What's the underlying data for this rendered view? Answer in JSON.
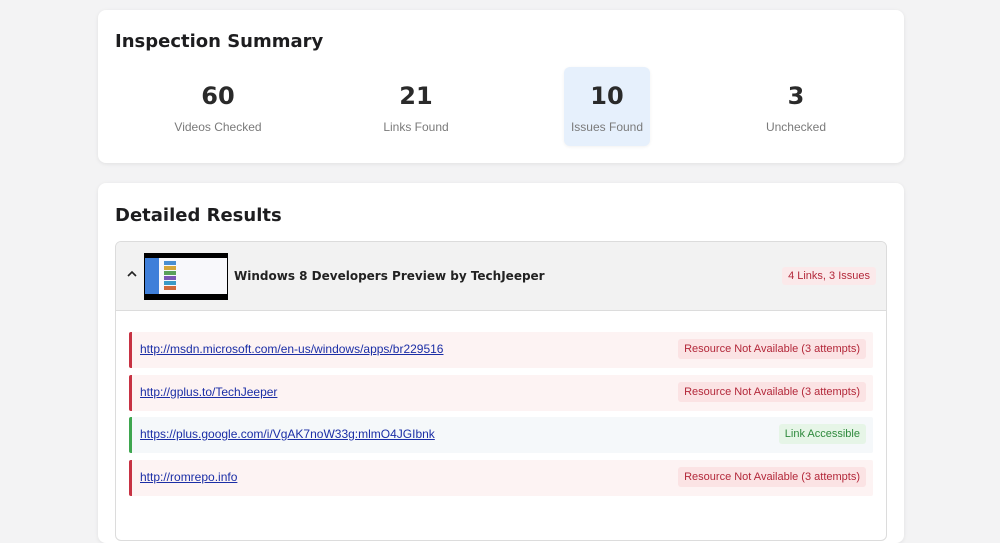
{
  "summary": {
    "title": "Inspection Summary",
    "stats": [
      {
        "value": "60",
        "label": "Videos Checked"
      },
      {
        "value": "21",
        "label": "Links Found"
      },
      {
        "value": "10",
        "label": "Issues Found"
      },
      {
        "value": "3",
        "label": "Unchecked"
      }
    ],
    "highlight_color": "#e6f0fc"
  },
  "results": {
    "title": "Detailed Results",
    "video": {
      "title": "Windows 8 Developers Preview by TechJeeper",
      "badge": "4 Links, 3 Issues",
      "expanded_icon": "chevron-up-icon",
      "links": [
        {
          "url": "http://msdn.microsoft.com/en-us/windows/apps/br229516",
          "status": "Resource Not Available (3 attempts)",
          "state": "error"
        },
        {
          "url": "http://gplus.to/TechJeeper",
          "status": "Resource Not Available (3 attempts)",
          "state": "error"
        },
        {
          "url": "https://plus.google.com/i/VgAK7noW33g:mlmO4JGIbnk",
          "status": "Link Accessible",
          "state": "ok"
        },
        {
          "url": "http://romrepo.info",
          "status": "Resource Not Available (3 attempts)",
          "state": "error"
        }
      ]
    }
  },
  "colors": {
    "error": "#c73243",
    "ok": "#3ea64f",
    "link": "#1b2ea6"
  }
}
